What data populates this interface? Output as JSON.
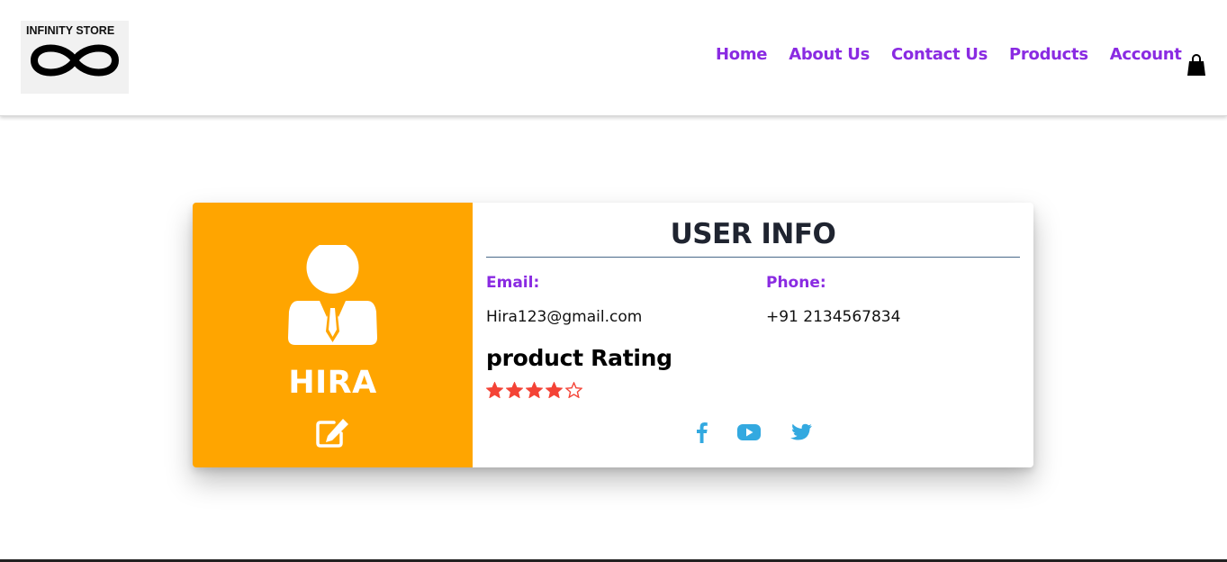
{
  "brand": {
    "logo_text": "INFINITY STORE"
  },
  "nav": {
    "links": [
      "Home",
      "About Us",
      "Contact Us",
      "Products",
      "Account"
    ]
  },
  "colors": {
    "accent": "#8a2be2",
    "card_left": "#ffa500",
    "stars": "#f44336",
    "social": "#33a9e0"
  },
  "icons": [
    "infinity-logo-icon",
    "shopping-bag-icon",
    "user-avatar-icon",
    "edit-icon",
    "star-icon",
    "facebook-icon",
    "youtube-icon",
    "twitter-icon"
  ],
  "user": {
    "name": "HIRA",
    "info_title": "USER INFO",
    "email_label": "Email:",
    "email": "Hira123@gmail.com",
    "phone_label": "Phone:",
    "phone": "+91 2134567834",
    "rating_heading": "product Rating",
    "rating": 4,
    "rating_max": 5
  }
}
